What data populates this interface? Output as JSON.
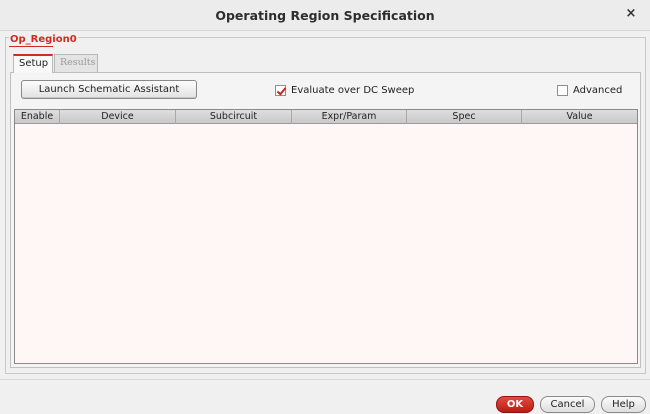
{
  "window": {
    "title": "Operating Region Specification",
    "close_glyph": "×"
  },
  "region": {
    "label": "Op_Region0",
    "accent_color": "#d12a20"
  },
  "tabs": [
    {
      "label": "Setup",
      "active": true
    },
    {
      "label": "Results",
      "disabled": true
    }
  ],
  "toolbar": {
    "launch_label": "Launch Schematic Assistant",
    "evaluate_label": "Evaluate over DC Sweep",
    "evaluate_checked": true,
    "advanced_label": "Advanced",
    "advanced_checked": false
  },
  "table": {
    "columns": [
      "Enable",
      "Device",
      "Subcircuit",
      "Expr/Param",
      "Spec",
      "Value"
    ],
    "rows": []
  },
  "footer": {
    "ok_label": "OK",
    "cancel_label": "Cancel",
    "help_label": "Help"
  }
}
